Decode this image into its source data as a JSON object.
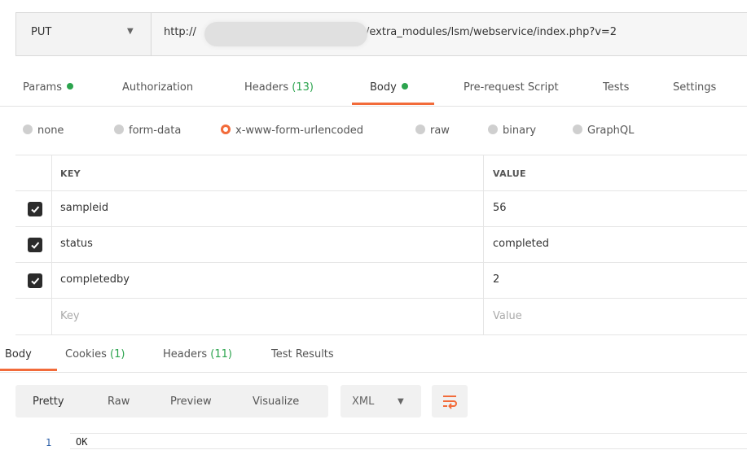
{
  "request": {
    "method": "PUT",
    "url_prefix": "http://",
    "url_suffix": "/extra_modules/lsm/webservice/index.php?v=2"
  },
  "request_tabs": [
    {
      "label": "Params"
    },
    {
      "label": "Authorization"
    },
    {
      "label": "Headers",
      "count": "(13)"
    },
    {
      "label": "Body"
    },
    {
      "label": "Pre-request Script"
    },
    {
      "label": "Tests"
    },
    {
      "label": "Settings"
    }
  ],
  "body_types": [
    "none",
    "form-data",
    "x-www-form-urlencoded",
    "raw",
    "binary",
    "GraphQL"
  ],
  "selected_body_type": "x-www-form-urlencoded",
  "table": {
    "headers": {
      "key": "KEY",
      "value": "VALUE"
    },
    "rows": [
      {
        "key": "sampleid",
        "value": "56",
        "checked": true
      },
      {
        "key": "status",
        "value": "completed",
        "checked": true
      },
      {
        "key": "completedby",
        "value": "2",
        "checked": true
      }
    ],
    "placeholder": {
      "key": "Key",
      "value": "Value"
    }
  },
  "response_tabs": [
    {
      "label": "Body"
    },
    {
      "label": "Cookies",
      "count": "(1)"
    },
    {
      "label": "Headers",
      "count": "(11)"
    },
    {
      "label": "Test Results"
    }
  ],
  "view_modes": [
    "Pretty",
    "Raw",
    "Preview",
    "Visualize"
  ],
  "format": "XML",
  "response_body": [
    {
      "line": "1",
      "text": "OK"
    }
  ],
  "colors": {
    "accent": "#f26b3a",
    "success": "#2ca44e"
  }
}
